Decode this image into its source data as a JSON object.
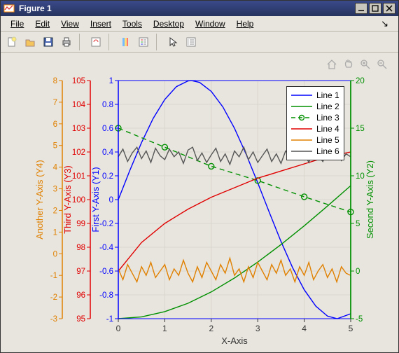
{
  "window": {
    "title": "Figure 1"
  },
  "menus": [
    {
      "u": "F",
      "rest": "ile"
    },
    {
      "u": "E",
      "rest": "dit"
    },
    {
      "u": "V",
      "rest": "iew"
    },
    {
      "u": "I",
      "rest": "nsert"
    },
    {
      "u": "T",
      "rest": "ools"
    },
    {
      "u": "D",
      "rest": "esktop"
    },
    {
      "u": "W",
      "rest": "indow"
    },
    {
      "u": "H",
      "rest": "elp"
    }
  ],
  "colors": {
    "y1": "#0000ff",
    "y2": "#009000",
    "y3": "#e00000",
    "y4": "#e08000",
    "grid": "#d9d6cd",
    "box": "#333333",
    "gray": "#555555"
  },
  "chart_data": {
    "type": "line",
    "xlabel": "X-Axis",
    "x_range": [
      0,
      5
    ],
    "x_ticks": [
      0,
      1,
      2,
      3,
      4,
      5
    ],
    "axes": [
      {
        "id": "y1",
        "label": "First Y-Axis (Y1)",
        "range": [
          -1,
          1
        ],
        "ticks": [
          -1,
          -0.8,
          -0.6,
          -0.4,
          -0.2,
          0,
          0.2,
          0.4,
          0.6,
          0.8,
          1
        ],
        "color": "y1",
        "side": "left",
        "offset": 0
      },
      {
        "id": "y2",
        "label": "Second Y-Axis (Y2)",
        "range": [
          -5,
          20
        ],
        "ticks": [
          -5,
          0,
          5,
          10,
          15,
          20
        ],
        "color": "y2",
        "side": "right",
        "offset": 0
      },
      {
        "id": "y3",
        "label": "Third Y-Axis (Y3)",
        "range": [
          95,
          105
        ],
        "ticks": [
          95,
          96,
          97,
          98,
          99,
          100,
          101,
          102,
          103,
          104,
          105
        ],
        "color": "y3",
        "side": "left",
        "offset": 1
      },
      {
        "id": "y4",
        "label": "Another Y-Axis (Y4)",
        "range": [
          -3,
          8
        ],
        "ticks": [
          -3,
          -2,
          -1,
          0,
          1,
          2,
          3,
          4,
          5,
          6,
          7,
          8
        ],
        "color": "y4",
        "side": "left",
        "offset": 2
      }
    ],
    "series": [
      {
        "name": "Line 1",
        "axis": "y1",
        "color": "y1",
        "style": "solid",
        "x": [
          0,
          0.25,
          0.5,
          0.75,
          1,
          1.25,
          1.5,
          1.57,
          1.75,
          2,
          2.25,
          2.5,
          2.75,
          3,
          3.25,
          3.5,
          3.75,
          4,
          4.25,
          4.5,
          4.71,
          5
        ],
        "y": [
          0,
          0.247,
          0.479,
          0.682,
          0.841,
          0.949,
          0.997,
          1.0,
          0.984,
          0.909,
          0.778,
          0.599,
          0.382,
          0.141,
          -0.108,
          -0.351,
          -0.572,
          -0.757,
          -0.895,
          -0.978,
          -1.0,
          -0.959
        ]
      },
      {
        "name": "Line 2",
        "axis": "y2",
        "color": "y2",
        "style": "solid",
        "x": [
          0,
          0.5,
          1,
          1.5,
          2,
          2.5,
          3,
          3.5,
          4,
          4.5,
          5
        ],
        "y": [
          -5,
          -4.81,
          -4.26,
          -3.38,
          -2.19,
          -0.73,
          0.94,
          2.78,
          4.75,
          6.82,
          8.96
        ]
      },
      {
        "name": "Line 3",
        "axis": "y2",
        "color": "y2",
        "style": "dashed",
        "markers": true,
        "x": [
          0,
          1,
          2,
          3,
          4,
          5
        ],
        "y": [
          15.0,
          13.0,
          11.0,
          9.5,
          7.8,
          6.2
        ]
      },
      {
        "name": "Line 4",
        "axis": "y3",
        "color": "y3",
        "style": "solid",
        "x": [
          0,
          0.5,
          1,
          1.5,
          2,
          2.5,
          3,
          3.5,
          4,
          4.5,
          5
        ],
        "y": [
          97.0,
          98.2,
          99.0,
          99.6,
          100.1,
          100.5,
          100.9,
          101.2,
          101.5,
          101.8,
          102.0
        ]
      },
      {
        "name": "Line 5",
        "axis": "y4",
        "color": "y4",
        "style": "solid",
        "x": [
          0,
          0.1,
          0.2,
          0.3,
          0.4,
          0.5,
          0.6,
          0.7,
          0.8,
          0.9,
          1,
          1.1,
          1.2,
          1.3,
          1.4,
          1.5,
          1.6,
          1.7,
          1.8,
          1.9,
          2,
          2.1,
          2.2,
          2.3,
          2.4,
          2.5,
          2.6,
          2.7,
          2.8,
          2.9,
          3,
          3.1,
          3.2,
          3.3,
          3.4,
          3.5,
          3.6,
          3.7,
          3.8,
          3.9,
          4,
          4.1,
          4.2,
          4.3,
          4.4,
          4.5,
          4.6,
          4.7,
          4.8,
          4.9,
          5
        ],
        "y": [
          -0.7,
          -1.2,
          -0.5,
          -0.9,
          -1.3,
          -0.6,
          -1.0,
          -0.4,
          -1.1,
          -0.8,
          -0.5,
          -1.2,
          -0.7,
          -1.0,
          -0.3,
          -0.9,
          -1.3,
          -0.6,
          -1.1,
          -0.4,
          -0.8,
          -1.2,
          -0.5,
          -0.9,
          -0.2,
          -1.0,
          -0.7,
          -1.3,
          -0.6,
          -1.1,
          -0.4,
          -0.8,
          -1.2,
          -0.5,
          -0.9,
          -0.3,
          -1.0,
          -0.7,
          -1.3,
          -0.6,
          -1.0,
          -0.4,
          -1.2,
          -0.8,
          -0.5,
          -1.1,
          -0.7,
          -1.3,
          -0.6,
          -0.9,
          -1.0
        ]
      },
      {
        "name": "Line 6",
        "axis": "y2",
        "color": "gray",
        "style": "solid",
        "x": [
          0,
          0.1,
          0.2,
          0.3,
          0.4,
          0.5,
          0.6,
          0.7,
          0.8,
          0.9,
          1,
          1.1,
          1.2,
          1.3,
          1.4,
          1.5,
          1.6,
          1.7,
          1.8,
          1.9,
          2,
          2.1,
          2.2,
          2.3,
          2.4,
          2.5,
          2.6,
          2.7,
          2.8,
          2.9,
          3,
          3.1,
          3.2,
          3.3,
          3.4,
          3.5,
          3.6,
          3.7,
          3.8,
          3.9,
          4,
          4.1,
          4.2,
          4.3,
          4.4,
          4.5,
          4.6,
          4.7,
          4.8,
          4.9,
          5
        ],
        "y": [
          12.0,
          12.8,
          11.5,
          12.4,
          13.0,
          11.8,
          12.6,
          11.4,
          12.9,
          12.1,
          11.7,
          12.8,
          12.0,
          12.5,
          11.3,
          12.7,
          13.0,
          11.6,
          12.4,
          11.4,
          12.2,
          12.9,
          11.5,
          12.3,
          11.2,
          12.6,
          12.0,
          13.0,
          11.7,
          12.5,
          11.4,
          12.1,
          12.8,
          11.5,
          12.3,
          11.3,
          12.6,
          12.0,
          13.0,
          11.7,
          12.4,
          11.4,
          12.9,
          12.1,
          11.5,
          12.7,
          12.0,
          13.0,
          11.6,
          12.3,
          12.0
        ]
      }
    ],
    "legend_entries": [
      "Line 1",
      "Line 2",
      "Line 3",
      "Line 4",
      "Line 5",
      "Line 6"
    ]
  }
}
